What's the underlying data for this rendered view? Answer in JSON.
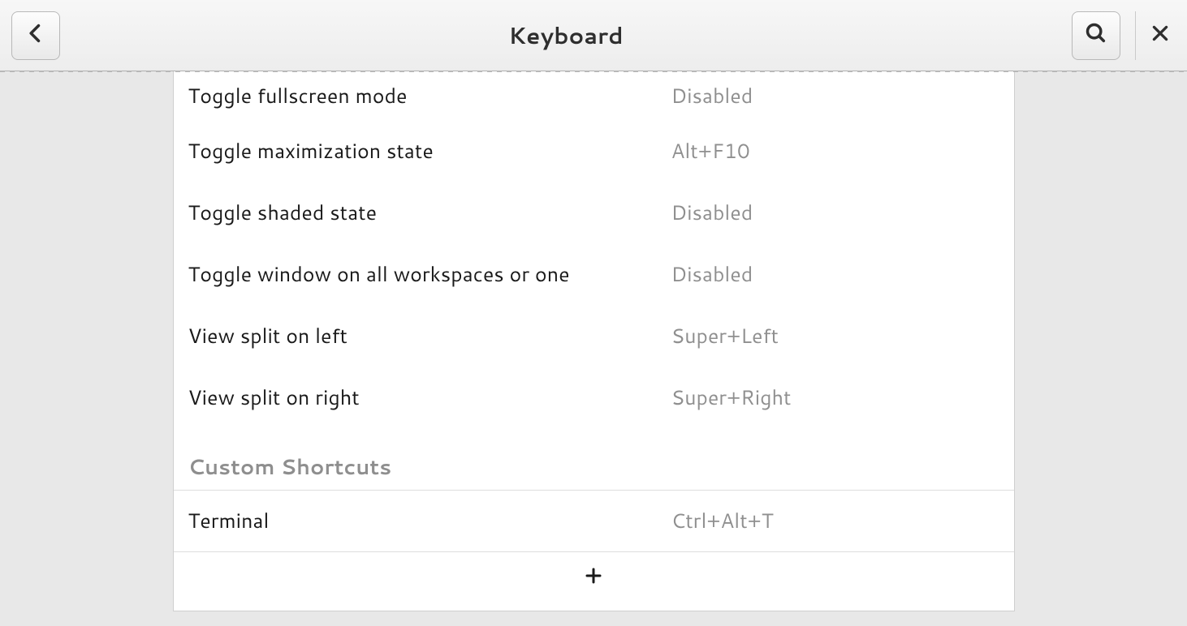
{
  "header": {
    "title": "Keyboard"
  },
  "shortcuts": [
    {
      "label": "Toggle fullscreen mode",
      "value": "Disabled"
    },
    {
      "label": "Toggle maximization state",
      "value": "Alt+F10"
    },
    {
      "label": "Toggle shaded state",
      "value": "Disabled"
    },
    {
      "label": "Toggle window on all workspaces or one",
      "value": "Disabled"
    },
    {
      "label": "View split on left",
      "value": "Super+Left"
    },
    {
      "label": "View split on right",
      "value": "Super+Right"
    }
  ],
  "custom_section": {
    "title": "Custom Shortcuts",
    "items": [
      {
        "label": "Terminal",
        "value": "Ctrl+Alt+T"
      }
    ]
  }
}
